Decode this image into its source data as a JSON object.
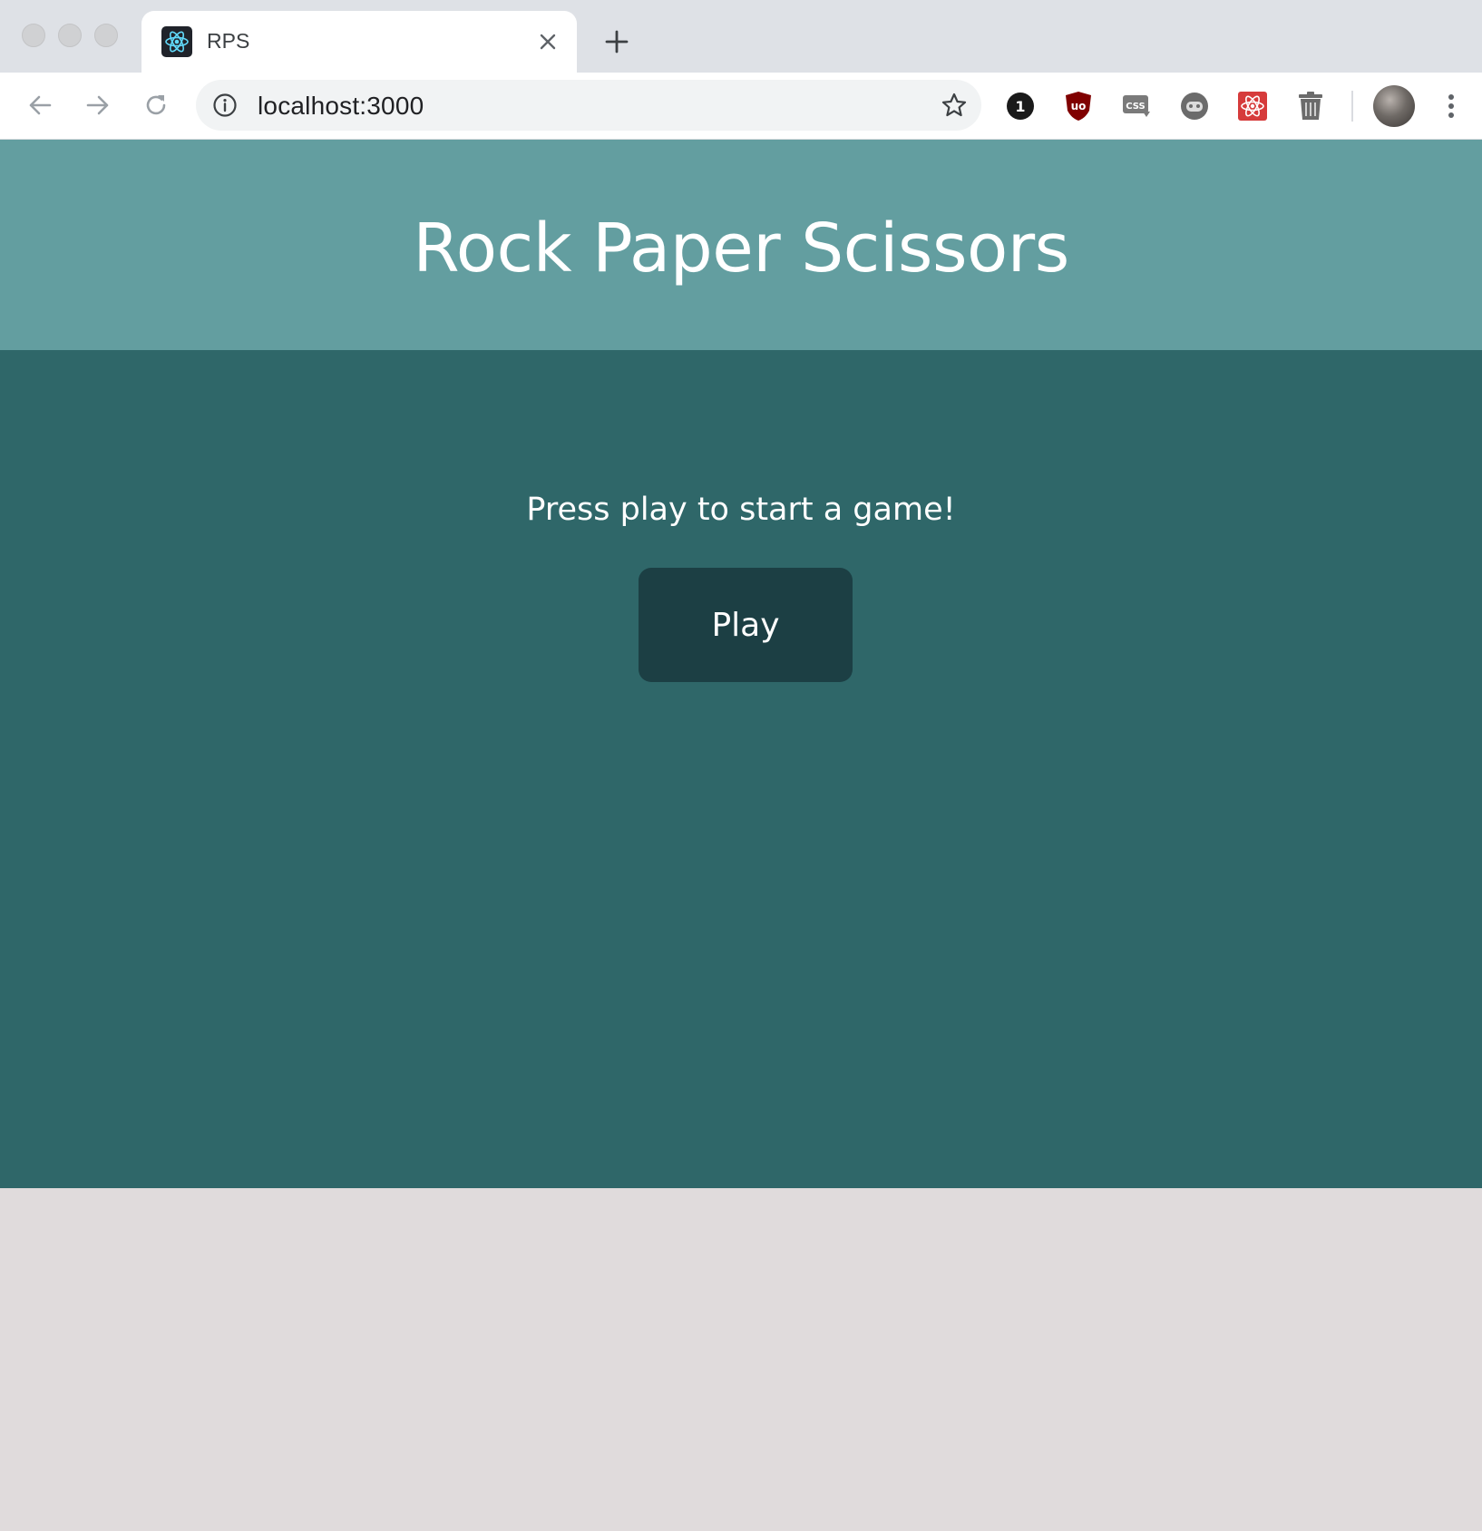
{
  "browser": {
    "tab": {
      "title": "RPS",
      "favicon": "react-atom-icon"
    },
    "address_bar": {
      "url": "localhost:3000"
    },
    "extensions": [
      "1password-icon",
      "ublock-origin-icon",
      "css-viewer-icon",
      "robot-face-icon",
      "react-devtools-icon",
      "trash-can-icon"
    ],
    "colors": {
      "tabbar": "#dee1e6",
      "toolbar": "#ffffff",
      "omnibox": "#f1f3f4"
    }
  },
  "page": {
    "title": "Rock Paper Scissors",
    "prompt": "Press play to start a game!",
    "play_button_label": "Play",
    "colors": {
      "header_bg": "#639ea0",
      "main_bg": "#2f6769",
      "button_bg": "#1c3f44",
      "footer_bg": "#e0dbdc",
      "text": "#ffffff"
    }
  }
}
